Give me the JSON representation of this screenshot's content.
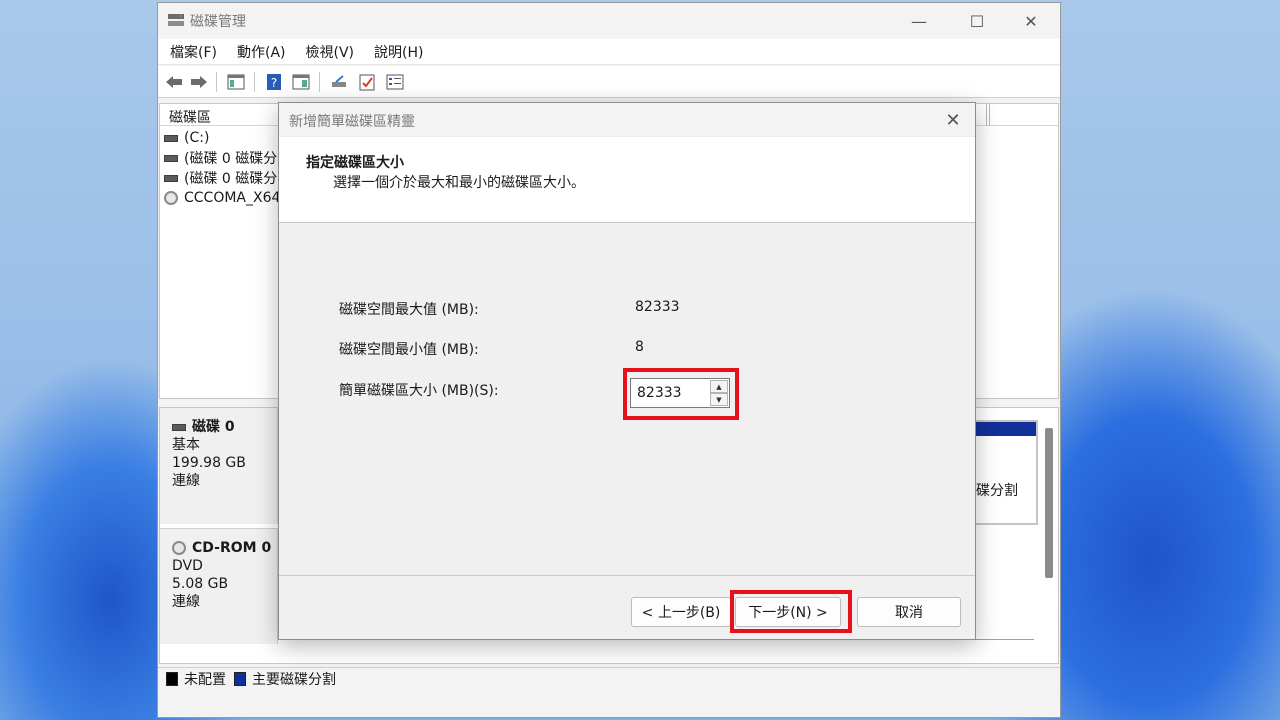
{
  "app": {
    "title": "磁碟管理",
    "window_controls": {
      "minimize": "—",
      "maximize": "☐",
      "close": "✕"
    }
  },
  "menu": [
    "檔案(F)",
    "動作(A)",
    "檢視(V)",
    "說明(H)"
  ],
  "toolbar_icons": [
    "back-icon",
    "forward-icon",
    "console-tree-icon",
    "help-icon",
    "action-pane-icon",
    "connect-icon",
    "check-icon",
    "properties-icon"
  ],
  "volume_list": {
    "column_header": "磁碟區",
    "rows": [
      {
        "icon": "drive-icon",
        "label": "(C:)"
      },
      {
        "icon": "drive-icon",
        "label": "(磁碟 0 磁碟分"
      },
      {
        "icon": "drive-icon",
        "label": "(磁碟 0 磁碟分"
      },
      {
        "icon": "cd-icon",
        "label": "CCCOMA_X64"
      }
    ]
  },
  "disks": [
    {
      "name": "磁碟 0",
      "type": "基本",
      "size": "199.98 GB",
      "status": "連線"
    },
    {
      "name": "CD-ROM 0",
      "type": "DVD",
      "size": "5.08 GB",
      "status": "連線"
    }
  ],
  "partition_label": "磁碟分割",
  "legend": [
    {
      "label": "未配置",
      "color": "#000000"
    },
    {
      "label": "主要磁碟分割",
      "color": "#12309a"
    }
  ],
  "wizard": {
    "title": "新增簡單磁碟區精靈",
    "heading": "指定磁碟區大小",
    "subheading": "選擇一個介於最大和最小的磁碟區大小。",
    "fields": {
      "max_label": "磁碟空間最大值 (MB):",
      "max_value": "82333",
      "min_label": "磁碟空間最小值 (MB):",
      "min_value": "8",
      "size_label": "簡單磁碟區大小 (MB)(S):",
      "size_value": "82333"
    },
    "buttons": {
      "back": "< 上一步(B)",
      "next": "下一步(N) >",
      "cancel": "取消"
    },
    "highlight_color": "#e8101a"
  }
}
